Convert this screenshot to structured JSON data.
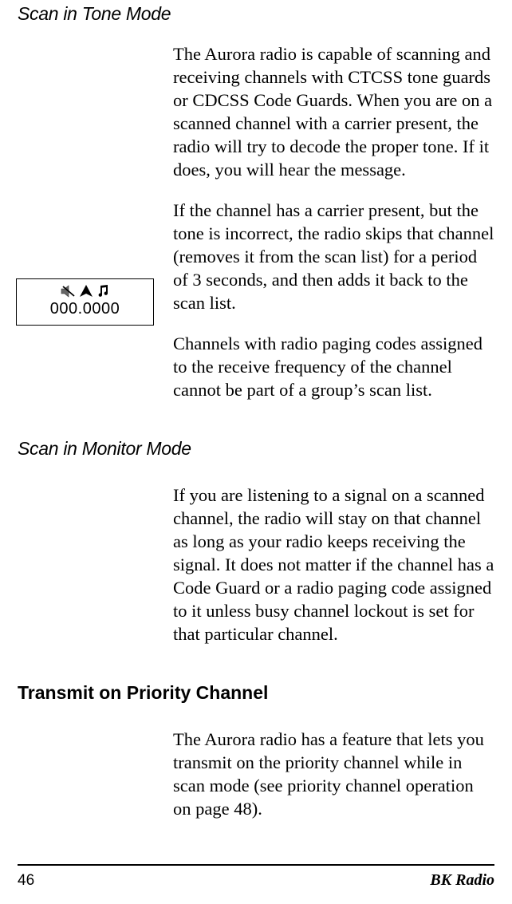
{
  "headings": {
    "h1": "Scan in Tone Mode",
    "h2": "Scan in Monitor Mode",
    "h3": "Transmit on Priority Channel"
  },
  "paragraphs": {
    "p1": "The Aurora radio is capable of scanning and receiving channels with CTCSS tone guards or CDCSS Code Guards. When you are on a scanned channel with a carrier present, the radio will try to decode the proper tone. If it does, you will hear the message.",
    "p2": "If the channel has a carrier present, but the tone is incorrect, the radio skips that channel (removes it from the scan list) for a period of 3 seconds, and then adds it back to the scan list.",
    "p3": "Channels with radio paging codes assigned to the receive frequency of the channel cannot be part of a group’s scan list.",
    "p4": "If you are listening to a signal on a scanned channel, the radio will stay on that channel as long as your radio keeps receiving the signal. It does not matter if the channel has a Code Guard or a radio paging code assigned to it unless busy channel lockout is set for that particular channel.",
    "p5": "The Aurora radio has a feature that lets you transmit on the priority channel while in scan mode (see priority channel operation on page 48)."
  },
  "display": {
    "frequency": "000.0000"
  },
  "footer": {
    "page": "46",
    "brand": "BK Radio"
  }
}
